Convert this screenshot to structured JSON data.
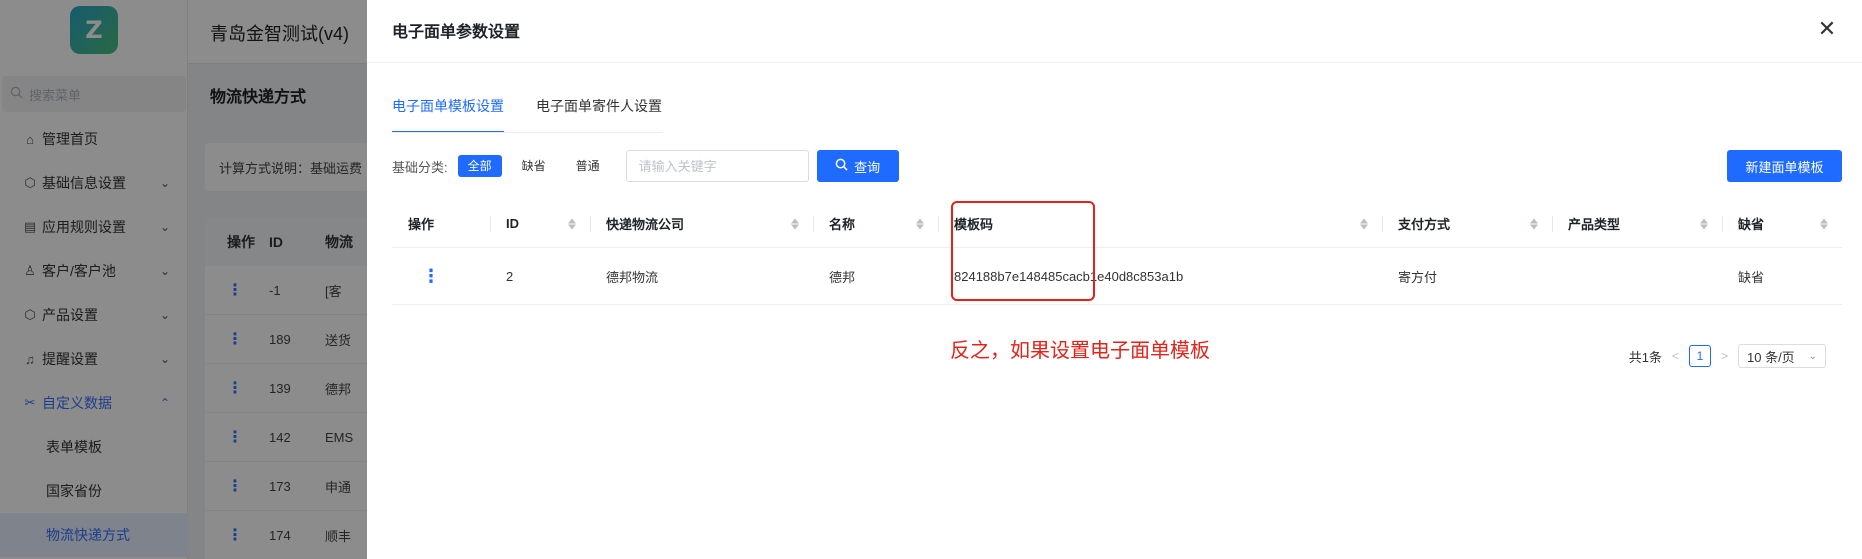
{
  "app": {
    "logo_text": "Z",
    "title": "青岛金智测试(v4)",
    "search_placeholder": "搜索菜单",
    "menu": [
      {
        "label": "管理首页",
        "icon": "home-icon",
        "glyph": "⌂",
        "has_chevron": false
      },
      {
        "label": "基础信息设置",
        "icon": "cube-icon",
        "glyph": "⬡",
        "has_chevron": true,
        "chevron": "⌄"
      },
      {
        "label": "应用规则设置",
        "icon": "document-icon",
        "glyph": "▤",
        "has_chevron": true,
        "chevron": "⌄"
      },
      {
        "label": "客户/客户池",
        "icon": "user-icon",
        "glyph": "♙",
        "has_chevron": true,
        "chevron": "⌄"
      },
      {
        "label": "产品设置",
        "icon": "cube-icon",
        "glyph": "⬡",
        "has_chevron": true,
        "chevron": "⌄"
      },
      {
        "label": "提醒设置",
        "icon": "bell-icon",
        "glyph": "♫",
        "has_chevron": true,
        "chevron": "⌄"
      },
      {
        "label": "自定义数据",
        "icon": "tools-icon",
        "glyph": "✂",
        "has_chevron": true,
        "chevron": "⌃"
      }
    ],
    "submenu": [
      "表单模板",
      "国家省份",
      "物流快递方式"
    ],
    "page_title": "物流快递方式",
    "calc_note": "计算方式说明：基础运费",
    "bg_table": {
      "headers": [
        "操作",
        "ID",
        "物流"
      ],
      "rows": [
        {
          "id": "-1",
          "name": "[客"
        },
        {
          "id": "189",
          "name": "送货"
        },
        {
          "id": "139",
          "name": "德邦"
        },
        {
          "id": "142",
          "name": "EMS"
        },
        {
          "id": "173",
          "name": "申通"
        },
        {
          "id": "174",
          "name": "顺丰"
        }
      ],
      "row_action_glyph": "⋮"
    }
  },
  "drawer": {
    "title": "电子面单参数设置",
    "close_glyph": "✕",
    "tabs": [
      {
        "label": "电子面单模板设置",
        "active": true
      },
      {
        "label": "电子面单寄件人设置",
        "active": false
      }
    ],
    "filter": {
      "label": "基础分类:",
      "chips": [
        {
          "label": "全部",
          "active": true
        },
        {
          "label": "缺省",
          "active": false
        },
        {
          "label": "普通",
          "active": false
        }
      ],
      "search_placeholder": "请输入关键字",
      "search_value": "",
      "search_button": "查询"
    },
    "new_button": "新建面单模板",
    "table": {
      "headers": [
        "操作",
        "ID",
        "快递物流公司",
        "名称",
        "模板码",
        "支付方式",
        "产品类型",
        "缺省"
      ],
      "rows": [
        {
          "op": "⋮",
          "id": "2",
          "company": "德邦物流",
          "name": "德邦",
          "code": "824188b7e148485cacb1e40d8c853a1b",
          "pay": "寄方付",
          "product_type": "",
          "default": "缺省"
        }
      ]
    },
    "annotation": "反之，如果设置电子面单模板",
    "pagination": {
      "total": "共1条",
      "prev": "<",
      "page": "1",
      "next": ">",
      "page_size": "10 条/页",
      "page_size_chevron": "⌄"
    }
  },
  "colors": {
    "accent": "#1f6bff",
    "annotation": "#e2231a",
    "mask": "rgba(0,0,0,0.45)"
  }
}
